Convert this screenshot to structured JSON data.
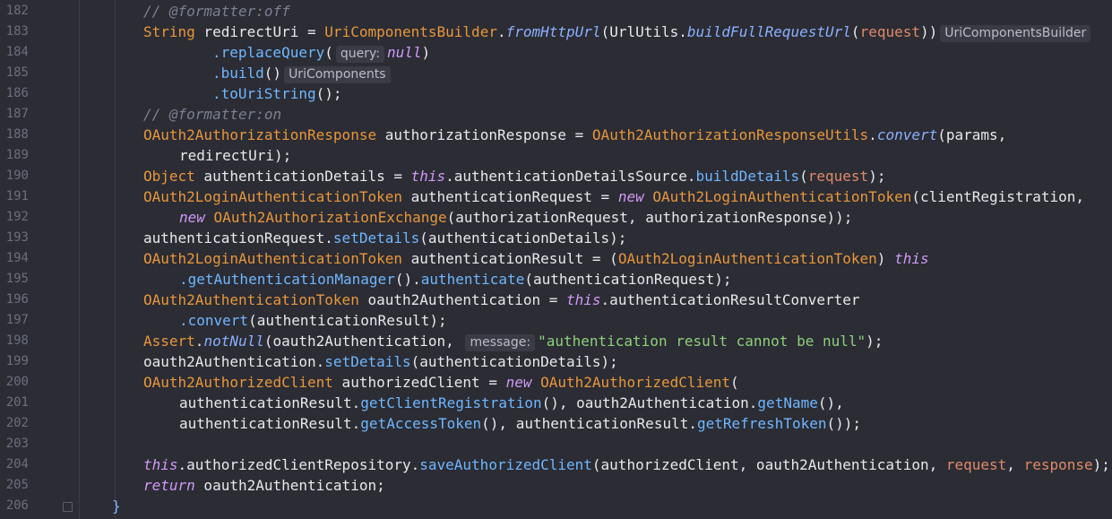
{
  "editor": {
    "lines": [
      {
        "n": "182",
        "indent": 2,
        "tokens": [
          [
            "c",
            "// @formatter:off"
          ]
        ]
      },
      {
        "n": "183",
        "indent": 2,
        "tokens": [
          [
            "k",
            "String"
          ],
          [
            "f",
            " redirectUri = "
          ],
          [
            "k",
            "UriComponentsBuilder"
          ],
          [
            "f",
            "."
          ],
          [
            "mi",
            "fromHttpUrl"
          ],
          [
            "f",
            "(UrlUtils."
          ],
          [
            "mi",
            "buildFullRequestUrl"
          ],
          [
            "f",
            "("
          ],
          [
            "p",
            "request"
          ],
          [
            "f",
            "))"
          ],
          [
            "hint",
            "UriComponentsBuilder"
          ]
        ]
      },
      {
        "n": "184",
        "indent": 4,
        "tokens": [
          [
            "m",
            ".replaceQuery"
          ],
          [
            "f",
            "("
          ],
          [
            "hint",
            "query:"
          ],
          [
            "kw",
            "null"
          ],
          [
            "f",
            ")"
          ]
        ]
      },
      {
        "n": "185",
        "indent": 4,
        "tokens": [
          [
            "m",
            ".build"
          ],
          [
            "f",
            "()"
          ],
          [
            "hint",
            "UriComponents"
          ]
        ]
      },
      {
        "n": "186",
        "indent": 4,
        "tokens": [
          [
            "m",
            ".toUriString"
          ],
          [
            "f",
            "();"
          ]
        ]
      },
      {
        "n": "187",
        "indent": 2,
        "tokens": [
          [
            "c",
            "// @formatter:on"
          ]
        ]
      },
      {
        "n": "188",
        "indent": 2,
        "tokens": [
          [
            "k",
            "OAuth2AuthorizationResponse"
          ],
          [
            "f",
            " authorizationResponse = "
          ],
          [
            "k",
            "OAuth2AuthorizationResponseUtils"
          ],
          [
            "f",
            "."
          ],
          [
            "mi",
            "convert"
          ],
          [
            "f",
            "(params,"
          ]
        ]
      },
      {
        "n": "189",
        "indent": 3,
        "tokens": [
          [
            "f",
            "redirectUri);"
          ]
        ]
      },
      {
        "n": "190",
        "indent": 2,
        "tokens": [
          [
            "k",
            "Object"
          ],
          [
            "f",
            " authenticationDetails = "
          ],
          [
            "kw",
            "this"
          ],
          [
            "f",
            ".authenticationDetailsSource."
          ],
          [
            "m",
            "buildDetails"
          ],
          [
            "f",
            "("
          ],
          [
            "p",
            "request"
          ],
          [
            "f",
            ");"
          ]
        ]
      },
      {
        "n": "191",
        "indent": 2,
        "tokens": [
          [
            "k",
            "OAuth2LoginAuthenticationToken"
          ],
          [
            "f",
            " authenticationRequest = "
          ],
          [
            "kw",
            "new"
          ],
          [
            "f",
            " "
          ],
          [
            "k",
            "OAuth2LoginAuthenticationToken"
          ],
          [
            "f",
            "(clientRegistration,"
          ]
        ]
      },
      {
        "n": "192",
        "indent": 3,
        "tokens": [
          [
            "kw",
            "new"
          ],
          [
            "f",
            " "
          ],
          [
            "k",
            "OAuth2AuthorizationExchange"
          ],
          [
            "f",
            "(authorizationRequest, authorizationResponse));"
          ]
        ]
      },
      {
        "n": "193",
        "indent": 2,
        "tokens": [
          [
            "f",
            "authenticationRequest."
          ],
          [
            "m",
            "setDetails"
          ],
          [
            "f",
            "(authenticationDetails);"
          ]
        ]
      },
      {
        "n": "194",
        "indent": 2,
        "tokens": [
          [
            "k",
            "OAuth2LoginAuthenticationToken"
          ],
          [
            "f",
            " authenticationResult = ("
          ],
          [
            "k",
            "OAuth2LoginAuthenticationToken"
          ],
          [
            "f",
            ") "
          ],
          [
            "kw",
            "this"
          ]
        ]
      },
      {
        "n": "195",
        "indent": 3,
        "tokens": [
          [
            "m",
            ".getAuthenticationManager"
          ],
          [
            "f",
            "()."
          ],
          [
            "m",
            "authenticate"
          ],
          [
            "f",
            "(authenticationRequest);"
          ]
        ]
      },
      {
        "n": "196",
        "indent": 2,
        "tokens": [
          [
            "k",
            "OAuth2AuthenticationToken"
          ],
          [
            "f",
            " oauth2Authentication = "
          ],
          [
            "kw",
            "this"
          ],
          [
            "f",
            ".authenticationResultConverter"
          ]
        ]
      },
      {
        "n": "197",
        "indent": 3,
        "tokens": [
          [
            "m",
            ".convert"
          ],
          [
            "f",
            "(authenticationResult);"
          ]
        ]
      },
      {
        "n": "198",
        "indent": 2,
        "tokens": [
          [
            "k",
            "Assert"
          ],
          [
            "f",
            "."
          ],
          [
            "mi",
            "notNull"
          ],
          [
            "f",
            "(oauth2Authentication, "
          ],
          [
            "hint",
            "message:"
          ],
          [
            "s",
            "\"authentication result cannot be null\""
          ],
          [
            "f",
            ");"
          ]
        ]
      },
      {
        "n": "199",
        "indent": 2,
        "tokens": [
          [
            "f",
            "oauth2Authentication."
          ],
          [
            "m",
            "setDetails"
          ],
          [
            "f",
            "(authenticationDetails);"
          ]
        ]
      },
      {
        "n": "200",
        "indent": 2,
        "tokens": [
          [
            "k",
            "OAuth2AuthorizedClient"
          ],
          [
            "f",
            " authorizedClient = "
          ],
          [
            "kw",
            "new"
          ],
          [
            "f",
            " "
          ],
          [
            "k",
            "OAuth2AuthorizedClient"
          ],
          [
            "f",
            "("
          ]
        ]
      },
      {
        "n": "201",
        "indent": 3,
        "tokens": [
          [
            "f",
            "authenticationResult."
          ],
          [
            "m",
            "getClientRegistration"
          ],
          [
            "f",
            "(), oauth2Authentication."
          ],
          [
            "m",
            "getName"
          ],
          [
            "f",
            "(),"
          ]
        ]
      },
      {
        "n": "202",
        "indent": 3,
        "tokens": [
          [
            "f",
            "authenticationResult."
          ],
          [
            "m",
            "getAccessToken"
          ],
          [
            "f",
            "(), authenticationResult."
          ],
          [
            "m",
            "getRefreshToken"
          ],
          [
            "f",
            "());"
          ]
        ]
      },
      {
        "n": "203",
        "indent": 0,
        "tokens": []
      },
      {
        "n": "204",
        "indent": 2,
        "tokens": [
          [
            "kw",
            "this"
          ],
          [
            "f",
            ".authorizedClientRepository."
          ],
          [
            "m",
            "saveAuthorizedClient"
          ],
          [
            "f",
            "(authorizedClient, oauth2Authentication, "
          ],
          [
            "p",
            "request"
          ],
          [
            "f",
            ", "
          ],
          [
            "p",
            "response"
          ],
          [
            "f",
            ");"
          ]
        ]
      },
      {
        "n": "205",
        "indent": 2,
        "tokens": [
          [
            "kw",
            "return"
          ],
          [
            "f",
            " oauth2Authentication;"
          ]
        ]
      },
      {
        "n": "206",
        "indent": 1,
        "tokens": [
          [
            "brace",
            "}"
          ]
        ]
      }
    ]
  }
}
